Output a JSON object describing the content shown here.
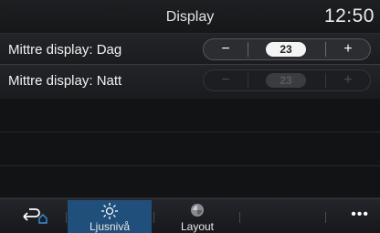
{
  "header": {
    "title": "Display",
    "time": "12:50"
  },
  "settings": [
    {
      "label": "Mittre display: Dag",
      "value": "23",
      "minus": "−",
      "plus": "+",
      "enabled": true
    },
    {
      "label": "Mittre display: Natt",
      "value": "23",
      "minus": "−",
      "plus": "+",
      "enabled": false
    }
  ],
  "bottom_bar": {
    "tabs": [
      {
        "label": "Ljusnivå",
        "icon": "sun-icon",
        "active": true
      },
      {
        "label": "Layout",
        "icon": "layout-icon",
        "active": false
      }
    ],
    "more": "•••",
    "accent": "#1f4f7a"
  }
}
